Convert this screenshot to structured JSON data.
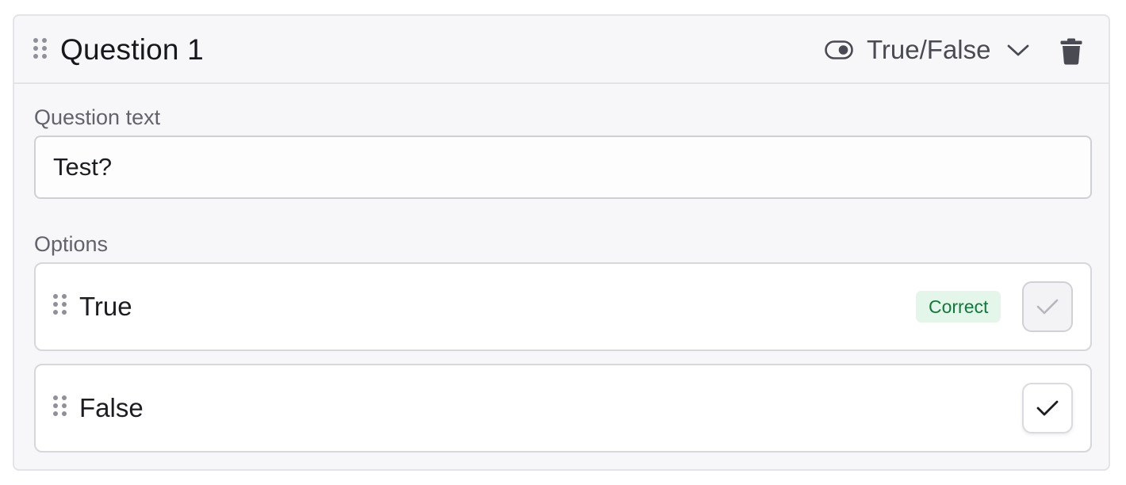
{
  "question": {
    "title": "Question 1",
    "type_label": "True/False",
    "icons": {
      "drag": "drag-handle-icon",
      "type": "toggle-icon",
      "dropdown": "chevron-down-icon",
      "delete": "trash-icon"
    }
  },
  "question_text": {
    "label": "Question text",
    "value": "Test?"
  },
  "options": {
    "label": "Options",
    "items": [
      {
        "label": "True",
        "badge": "Correct",
        "is_correct": true
      },
      {
        "label": "False",
        "is_correct": false
      }
    ]
  },
  "colors": {
    "card_background": "#f7f7f9",
    "border": "#e4e4e8",
    "badge_background": "#e4f5ea",
    "badge_text": "#0f7a3b",
    "muted_icon": "#8f9098"
  }
}
